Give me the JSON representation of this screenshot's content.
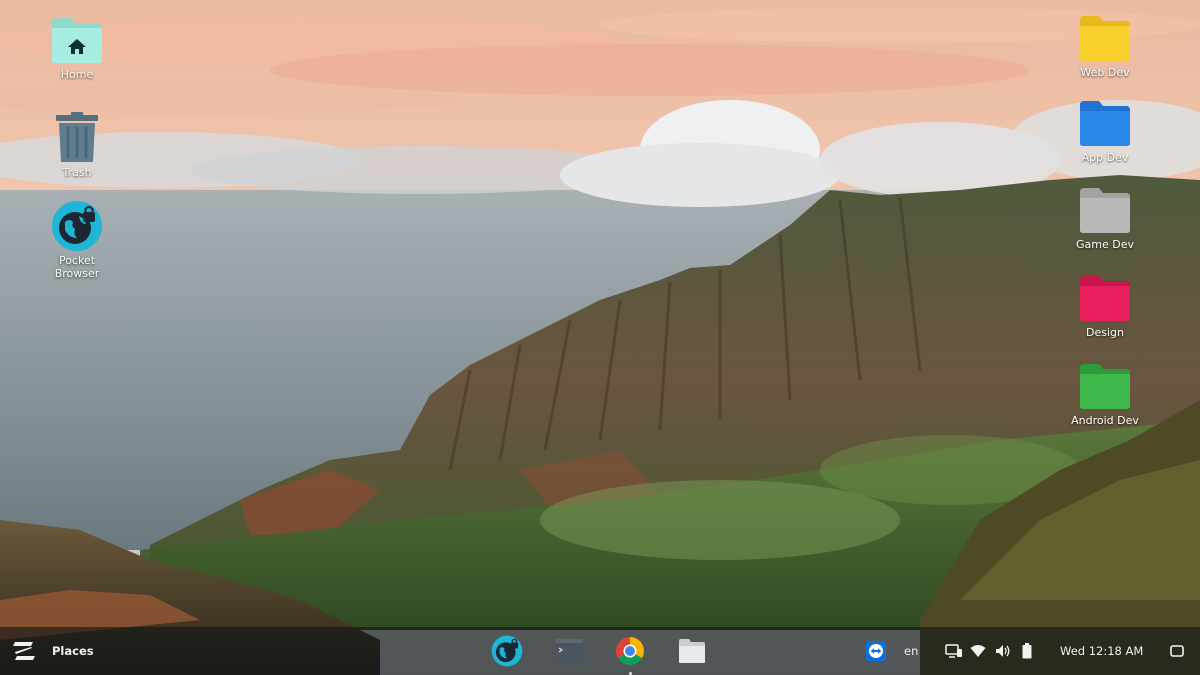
{
  "desktop": {
    "left_icons": [
      {
        "label": "Home",
        "icon": "home-folder-icon"
      },
      {
        "label": "Trash",
        "icon": "trash-icon"
      },
      {
        "label": "Pocket Browser",
        "icon": "pocket-browser-icon"
      }
    ],
    "right_icons": [
      {
        "label": "Web Dev",
        "icon": "folder-icon",
        "color": "#f9cf2b"
      },
      {
        "label": "App Dev",
        "icon": "folder-icon",
        "color": "#2a87ea"
      },
      {
        "label": "Game Dev",
        "icon": "folder-icon",
        "color": "#b9b9b9"
      },
      {
        "label": "Design",
        "icon": "folder-icon",
        "color": "#e81e5d"
      },
      {
        "label": "Android Dev",
        "icon": "folder-icon",
        "color": "#3fb84b"
      }
    ]
  },
  "taskbar": {
    "menu_icon": "zorin-menu-icon",
    "places_label": "Places",
    "dock": [
      {
        "app": "Pocket Browser",
        "icon": "pocket-browser-icon"
      },
      {
        "app": "Terminal",
        "icon": "terminal-icon"
      },
      {
        "app": "Chrome",
        "icon": "chrome-icon",
        "running": true
      },
      {
        "app": "Files",
        "icon": "files-icon"
      }
    ],
    "tray": {
      "teamviewer_icon": "teamviewer-icon",
      "language": "en",
      "clock": "Wed 12:18 AM"
    }
  },
  "colors": {
    "taskbar_bg": "#12161880",
    "accent_cyan": "#1fb5d6",
    "teamviewer_blue": "#0e6ee0"
  }
}
